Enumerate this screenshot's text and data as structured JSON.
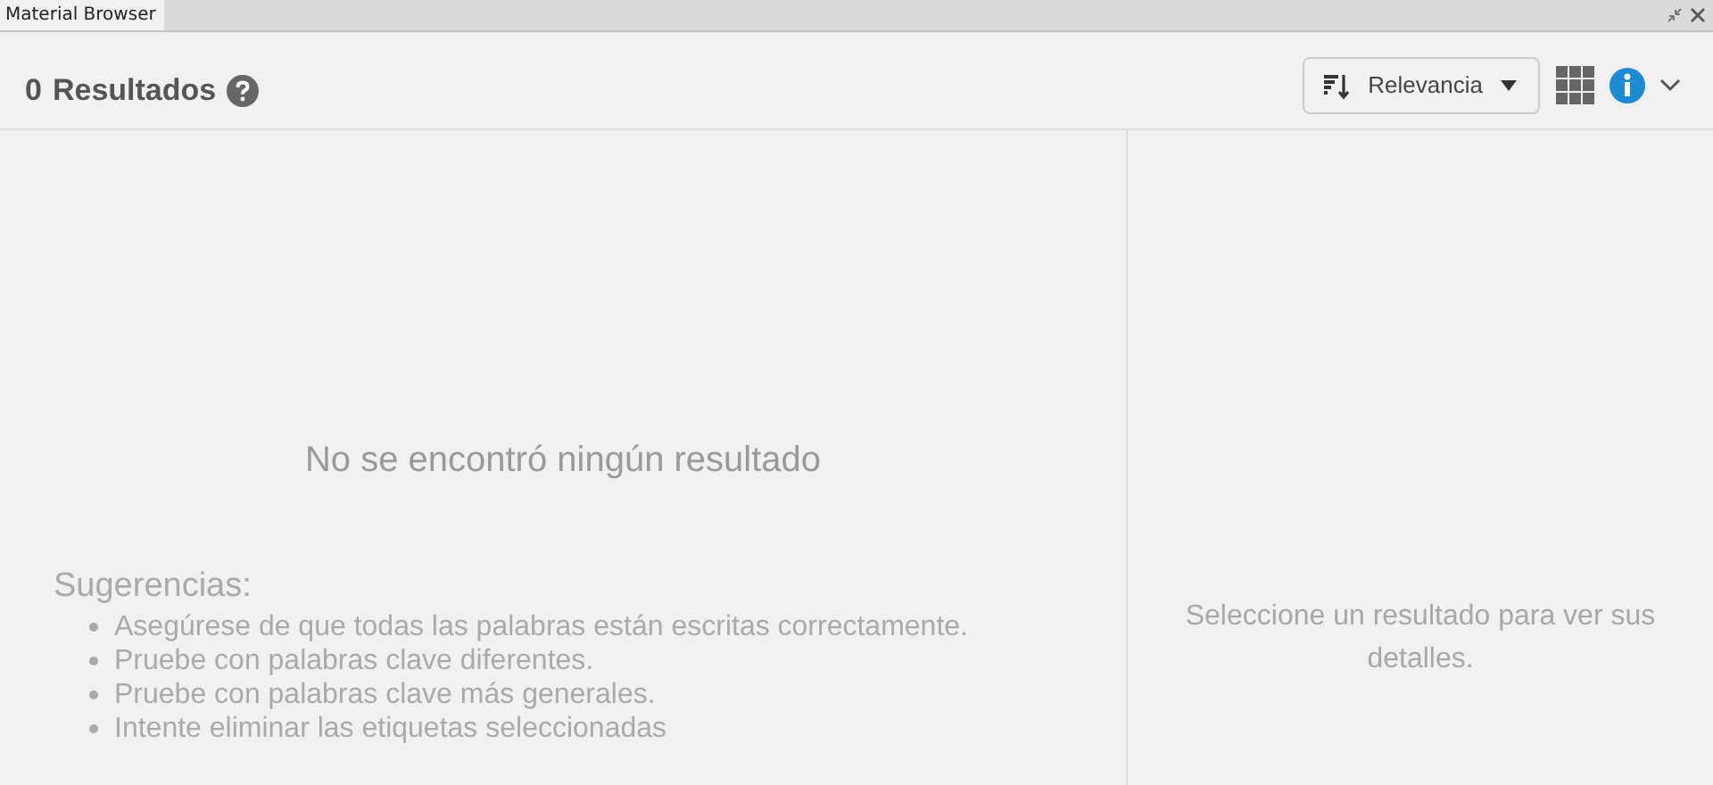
{
  "window": {
    "tab": "Material Browser"
  },
  "header": {
    "count": "0",
    "label": "Resultados"
  },
  "sort": {
    "label": "Relevancia"
  },
  "empty_message": "No se encontró ningún resultado",
  "suggestions": {
    "title": "Sugerencias:",
    "items": [
      "Asegúrese de que todas las palabras están escritas correctamente.",
      "Pruebe con palabras clave diferentes.",
      "Pruebe con palabras clave más generales.",
      "Intente eliminar las etiquetas seleccionadas"
    ]
  },
  "details_placeholder": "Seleccione un resultado para ver sus detalles."
}
